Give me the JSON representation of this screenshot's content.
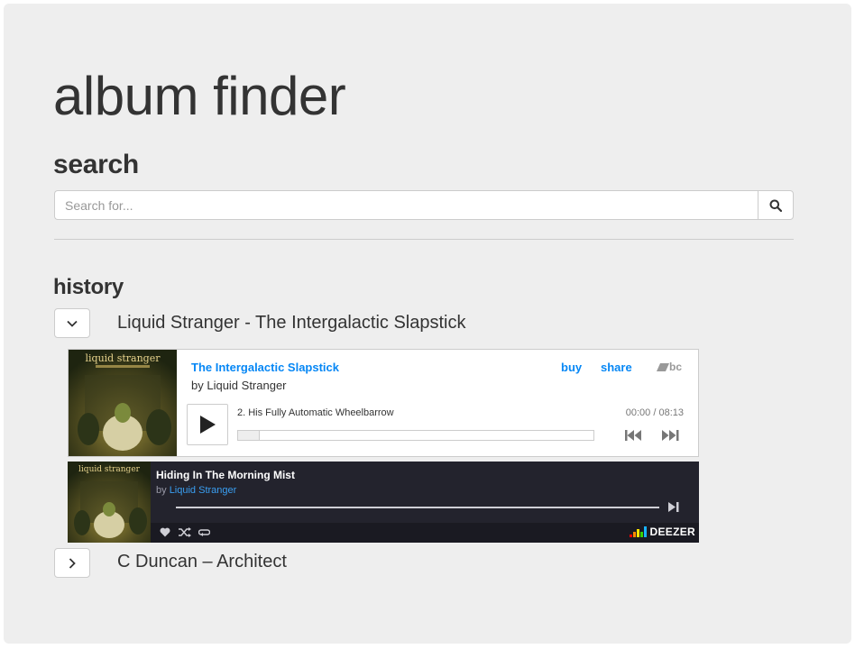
{
  "app": {
    "title": "album finder"
  },
  "search": {
    "heading": "search",
    "placeholder": "Search for...",
    "value": ""
  },
  "history": {
    "heading": "history",
    "items": [
      {
        "label": "Liquid Stranger - The Intergalactic Slapstick",
        "expanded": true
      },
      {
        "label": "C Duncan – Architect",
        "expanded": false
      }
    ]
  },
  "bandcamp_player": {
    "album": "The Intergalactic Slapstick",
    "artist_line": "by Liquid Stranger",
    "buy_label": "buy",
    "share_label": "share",
    "logo_text": "bc",
    "track": "2.  His Fully Automatic Wheelbarrow",
    "time": "00:00 / 08:13",
    "progress": 0.0,
    "cover_text": "liquid stranger"
  },
  "deezer_player": {
    "title": "Hiding In The Morning Mist",
    "by_label": "by",
    "artist": "Liquid Stranger",
    "brand": "DEEZER",
    "cover_text": "liquid stranger"
  },
  "colors": {
    "link_blue": "#0687f5",
    "panel_bg": "#eeeeee",
    "deezer_bg": "#23232d"
  }
}
